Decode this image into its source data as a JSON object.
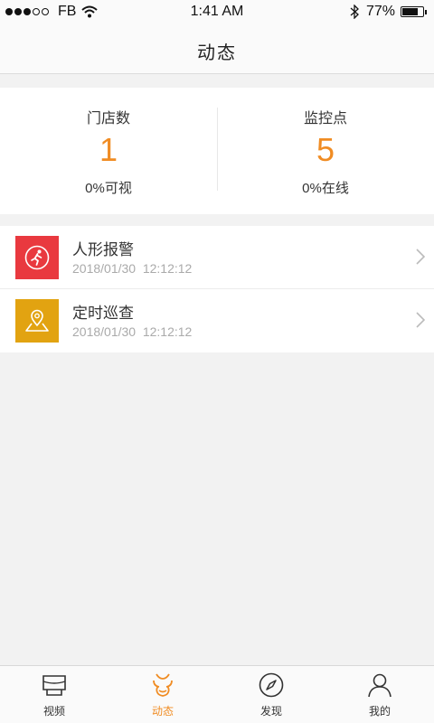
{
  "status_bar": {
    "carrier": "FB",
    "time": "1:41 AM",
    "battery": "77%",
    "battery_level": 0.77
  },
  "header": {
    "title": "动态"
  },
  "summary": {
    "stores": {
      "label": "门店数",
      "value": "1",
      "sub": "0%可视"
    },
    "points": {
      "label": "监控点",
      "value": "5",
      "sub": "0%在线"
    }
  },
  "events": [
    {
      "title": "人形报警",
      "time": "2018/01/30  12:12:12",
      "icon": "person-running-icon",
      "color": "#e9393f"
    },
    {
      "title": "定时巡查",
      "time": "2018/01/30  12:12:12",
      "icon": "map-pin-icon",
      "color": "#e2a311"
    }
  ],
  "tabs": [
    {
      "label": "视频",
      "icon": "video-icon",
      "active": false
    },
    {
      "label": "动态",
      "icon": "activity-icon",
      "active": true
    },
    {
      "label": "发现",
      "icon": "compass-icon",
      "active": false
    },
    {
      "label": "我的",
      "icon": "person-icon",
      "active": false
    }
  ],
  "colors": {
    "accent": "#f08c23",
    "alarm": "#e9393f",
    "patrol": "#e2a311",
    "background": "#f2f2f2"
  }
}
